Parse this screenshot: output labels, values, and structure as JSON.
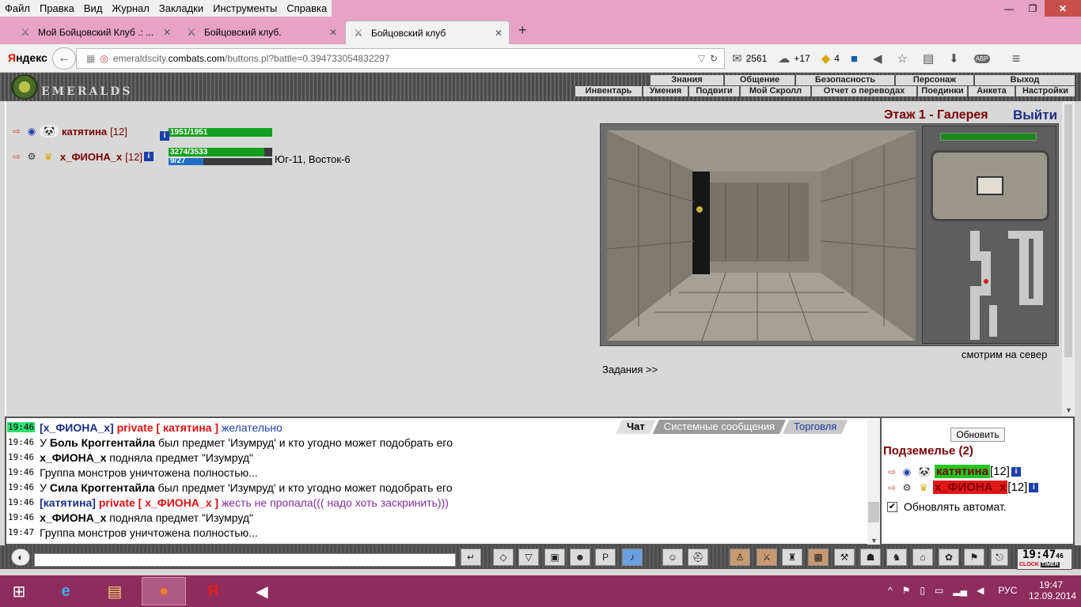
{
  "browser": {
    "menu": [
      "Файл",
      "Правка",
      "Вид",
      "Журнал",
      "Закладки",
      "Инструменты",
      "Справка"
    ],
    "tabs": [
      {
        "title": "Мой Бойцовский Клуб .: ..."
      },
      {
        "title": "Бойцовский клуб."
      },
      {
        "title": "Бойцовский клуб"
      }
    ],
    "search_brand_1": "Я",
    "search_brand_2": "ндекс",
    "url_prefix": "emeraldscity.",
    "url_host": "combats.com",
    "url_path": "/buttons.pl?battle=0.394733054832297",
    "mail_count": "2561",
    "weather": "+17",
    "chat_count": "4",
    "abp": "ABP"
  },
  "game": {
    "logo_text": "EMERALDS",
    "top_menu": [
      "Знания",
      "Общение",
      "Безопасность",
      "Персонаж",
      "Выход"
    ],
    "sub_menu": [
      "Инвентарь",
      "Умения",
      "Подвиги",
      "Мой Скролл",
      "Отчет о переводах",
      "Поединки",
      "Анкета",
      "Настройки"
    ],
    "players": [
      {
        "name": "катятина",
        "level": "[12]",
        "hp": "1951/1951",
        "hp_frac": 1.0
      },
      {
        "name": "x_ФИОНА_x",
        "level": "[12]",
        "hp": "3274/3533",
        "hp_frac": 0.927,
        "mp": "9/27",
        "mp_frac": 0.333,
        "location": "Юг-11, Восток-6"
      }
    ],
    "floor": "Этаж 1 - Галерея",
    "exit": "Выйти",
    "look_dir": "смотрим на север",
    "tasks": "Задания >>"
  },
  "chat": {
    "tabs": [
      "Чат",
      "Системные сообщения",
      "Торговля"
    ],
    "lines": [
      {
        "time": "19:46",
        "hl": true,
        "parts": [
          [
            "b",
            "[x_ФИОНА_x]"
          ],
          [
            "p",
            " private [ катятина ] "
          ],
          [
            "mb",
            "желательно"
          ]
        ]
      },
      {
        "time": "19:46",
        "parts": [
          [
            "t",
            "У "
          ],
          [
            "n",
            "Боль Кроггентайла"
          ],
          [
            "t",
            " был предмет 'Изумруд' и кто угодно может подобрать его"
          ]
        ]
      },
      {
        "time": "19:46",
        "parts": [
          [
            "n",
            "x_ФИОНА_x"
          ],
          [
            "t",
            " подняла предмет \"Изумруд\""
          ]
        ]
      },
      {
        "time": "19:46",
        "parts": [
          [
            "t",
            "Группа монстров уничтожена полностью..."
          ]
        ]
      },
      {
        "time": "19:46",
        "parts": [
          [
            "t",
            "У "
          ],
          [
            "n",
            "Сила Кроггентайла"
          ],
          [
            "t",
            " был предмет 'Изумруд' и кто угодно может подобрать его"
          ]
        ]
      },
      {
        "time": "19:46",
        "parts": [
          [
            "b",
            "[катятина]"
          ],
          [
            "p",
            " private [ x_ФИОНА_x ] "
          ],
          [
            "mp",
            "жесть не пропала((( надо хоть заскринить)))"
          ]
        ]
      },
      {
        "time": "19:46",
        "parts": [
          [
            "n",
            "x_ФИОНА_x"
          ],
          [
            "t",
            " подняла предмет \"Изумруд\""
          ]
        ]
      },
      {
        "time": "19:47",
        "parts": [
          [
            "t",
            "Группа монстров уничтожена полностью..."
          ]
        ]
      }
    ]
  },
  "users": {
    "refresh": "Обновить",
    "room": "Подземелье (2)",
    "list": [
      {
        "name": "катятина",
        "level": "[12]",
        "bg": "#22c822"
      },
      {
        "name": "x_ФИОНА_x",
        "level": "[12]",
        "bg": "#e01818"
      }
    ],
    "auto": "Обновлять автомат."
  },
  "clock": {
    "time": "19:47",
    "sec": "46",
    "l1": "CLOCK",
    "l2": "TIMER"
  },
  "taskbar": {
    "lang": "РУС",
    "time": "19:47",
    "date": "12.09.2014"
  }
}
